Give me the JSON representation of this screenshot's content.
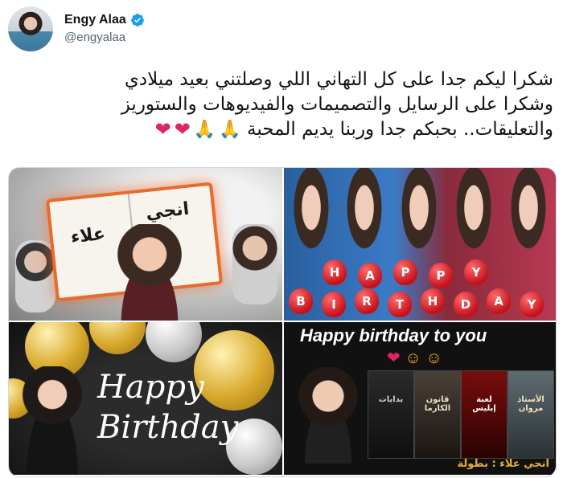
{
  "author": {
    "display_name": "Engy Alaa",
    "handle": "@engyalaa",
    "verified_icon": "verified-badge-icon",
    "verified_color": "#1d9bf0"
  },
  "tweet": {
    "lines": [
      "شكرا ليكم جدا على كل التهاني اللي وصلتني بعيد ميلادي",
      "وشكرا على الرسايل والتصميمات والفيديوهات والستوريز",
      "والتعليقات.. بحبكم جدا وربنا يديم المحبة"
    ],
    "emojis": [
      "folded-hands",
      "folded-hands",
      "red-heart",
      "red-heart"
    ]
  },
  "media": {
    "tile1": {
      "text_name_top": "انجي",
      "text_name_bottom": "علاء"
    },
    "tile2": {
      "balloons_row1": [
        "H",
        "A",
        "P",
        "P",
        "Y"
      ],
      "balloons_row2": [
        "B",
        "I",
        "R",
        "T",
        "H",
        "D",
        "A",
        "Y"
      ]
    },
    "tile3": {
      "script_line1": "Happy",
      "script_line2": "Birthday"
    },
    "tile4": {
      "banner": "Happy birthday to you",
      "poster_titles": [
        "بدايات",
        "قانون الكارما",
        "لعبة إبليس",
        "الأستاذ مروان"
      ],
      "credit": "انجي علاء : بطولة"
    }
  },
  "colors": {
    "heart": "#e0245e",
    "text_primary": "#0f1419",
    "text_secondary": "#536471"
  }
}
